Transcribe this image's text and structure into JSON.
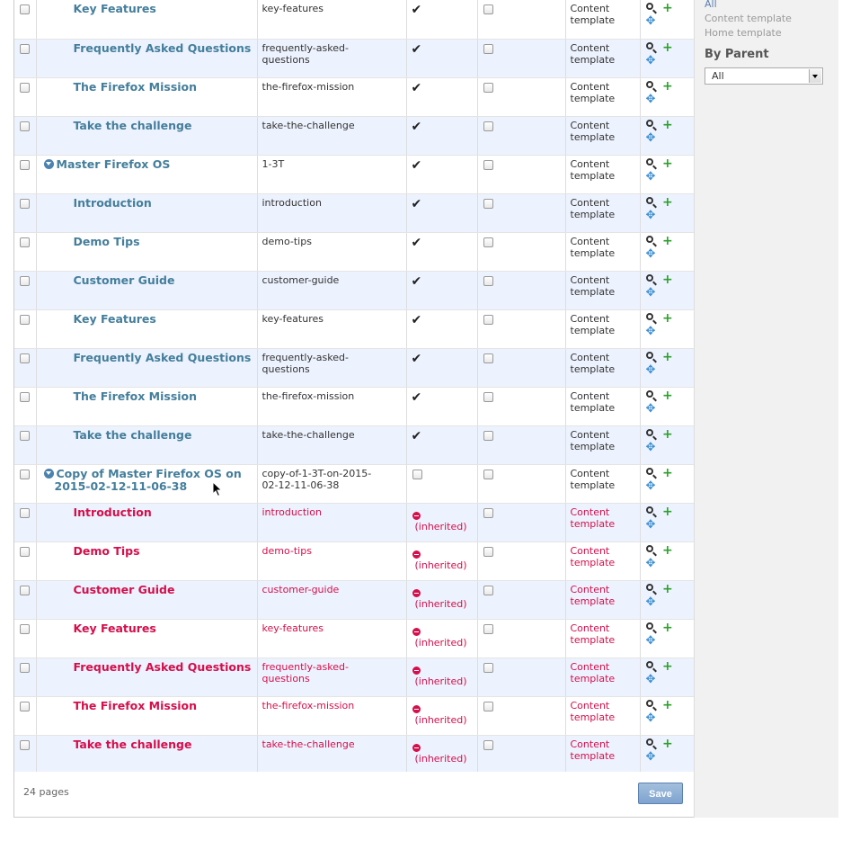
{
  "rows": [
    {
      "title": "Key Features",
      "slug": "key-features",
      "published": true,
      "level": "child",
      "style": "normal",
      "template": "Content template"
    },
    {
      "title": "Frequently Asked Questions",
      "slug": "frequently-asked-questions",
      "published": true,
      "level": "child",
      "style": "normal",
      "template": "Content template"
    },
    {
      "title": "The Firefox Mission",
      "slug": "the-firefox-mission",
      "published": true,
      "level": "child",
      "style": "normal",
      "template": "Content template"
    },
    {
      "title": "Take the challenge",
      "slug": "take-the-challenge",
      "published": true,
      "level": "child",
      "style": "normal",
      "template": "Content template"
    },
    {
      "title": "Master Firefox OS",
      "slug": "1-3T",
      "published": true,
      "level": "root",
      "style": "normal",
      "template": "Content template"
    },
    {
      "title": "Introduction",
      "slug": "introduction",
      "published": true,
      "level": "child",
      "style": "normal",
      "template": "Content template"
    },
    {
      "title": "Demo Tips",
      "slug": "demo-tips",
      "published": true,
      "level": "child",
      "style": "normal",
      "template": "Content template"
    },
    {
      "title": "Customer Guide",
      "slug": "customer-guide",
      "published": true,
      "level": "child",
      "style": "normal",
      "template": "Content template"
    },
    {
      "title": "Key Features",
      "slug": "key-features",
      "published": true,
      "level": "child",
      "style": "normal",
      "template": "Content template"
    },
    {
      "title": "Frequently Asked Questions",
      "slug": "frequently-asked-questions",
      "published": true,
      "level": "child",
      "style": "normal",
      "template": "Content template"
    },
    {
      "title": "The Firefox Mission",
      "slug": "the-firefox-mission",
      "published": true,
      "level": "child",
      "style": "normal",
      "template": "Content template"
    },
    {
      "title": "Take the challenge",
      "slug": "take-the-challenge",
      "published": true,
      "level": "child",
      "style": "normal",
      "template": "Content template"
    },
    {
      "title": "Copy of Master Firefox OS on",
      "title2": "2015-02-12-11-06-38",
      "slug": "copy-of-1-3T-on-2015-02-12-11-06-38",
      "published": false,
      "level": "root",
      "style": "normal",
      "template": "Content template"
    },
    {
      "title": "Introduction",
      "slug": "introduction",
      "published": "inherited",
      "level": "child",
      "style": "red",
      "template": "Content template"
    },
    {
      "title": "Demo Tips",
      "slug": "demo-tips",
      "published": "inherited",
      "level": "child",
      "style": "red",
      "template": "Content template"
    },
    {
      "title": "Customer Guide",
      "slug": "customer-guide",
      "published": "inherited",
      "level": "child",
      "style": "red",
      "template": "Content template"
    },
    {
      "title": "Key Features",
      "slug": "key-features",
      "published": "inherited",
      "level": "child",
      "style": "red",
      "template": "Content template"
    },
    {
      "title": "Frequently Asked Questions",
      "slug": "frequently-asked-questions",
      "published": "inherited",
      "level": "child",
      "style": "red",
      "template": "Content template"
    },
    {
      "title": "The Firefox Mission",
      "slug": "the-firefox-mission",
      "published": "inherited",
      "level": "child",
      "style": "red",
      "template": "Content template"
    },
    {
      "title": "Take the challenge",
      "slug": "take-the-challenge",
      "published": "inherited",
      "level": "child",
      "style": "red",
      "template": "Content template"
    }
  ],
  "inherited_label": "(inherited)",
  "footer": {
    "page_count": "24 pages",
    "save_label": "Save"
  },
  "filter": {
    "all": "All",
    "options": [
      "Content template",
      "Home template"
    ],
    "by_parent_heading": "By Parent",
    "by_parent_value": "All"
  },
  "colors": {
    "link": "#447e9b",
    "inherited": "#d40f4b",
    "row_alt": "#edf3fe",
    "accent": "#5b80b2"
  },
  "icons": {
    "view": "magnifier-icon",
    "add": "plus-icon",
    "move": "move-arrows-icon",
    "expand": "expand-triangle-icon"
  }
}
